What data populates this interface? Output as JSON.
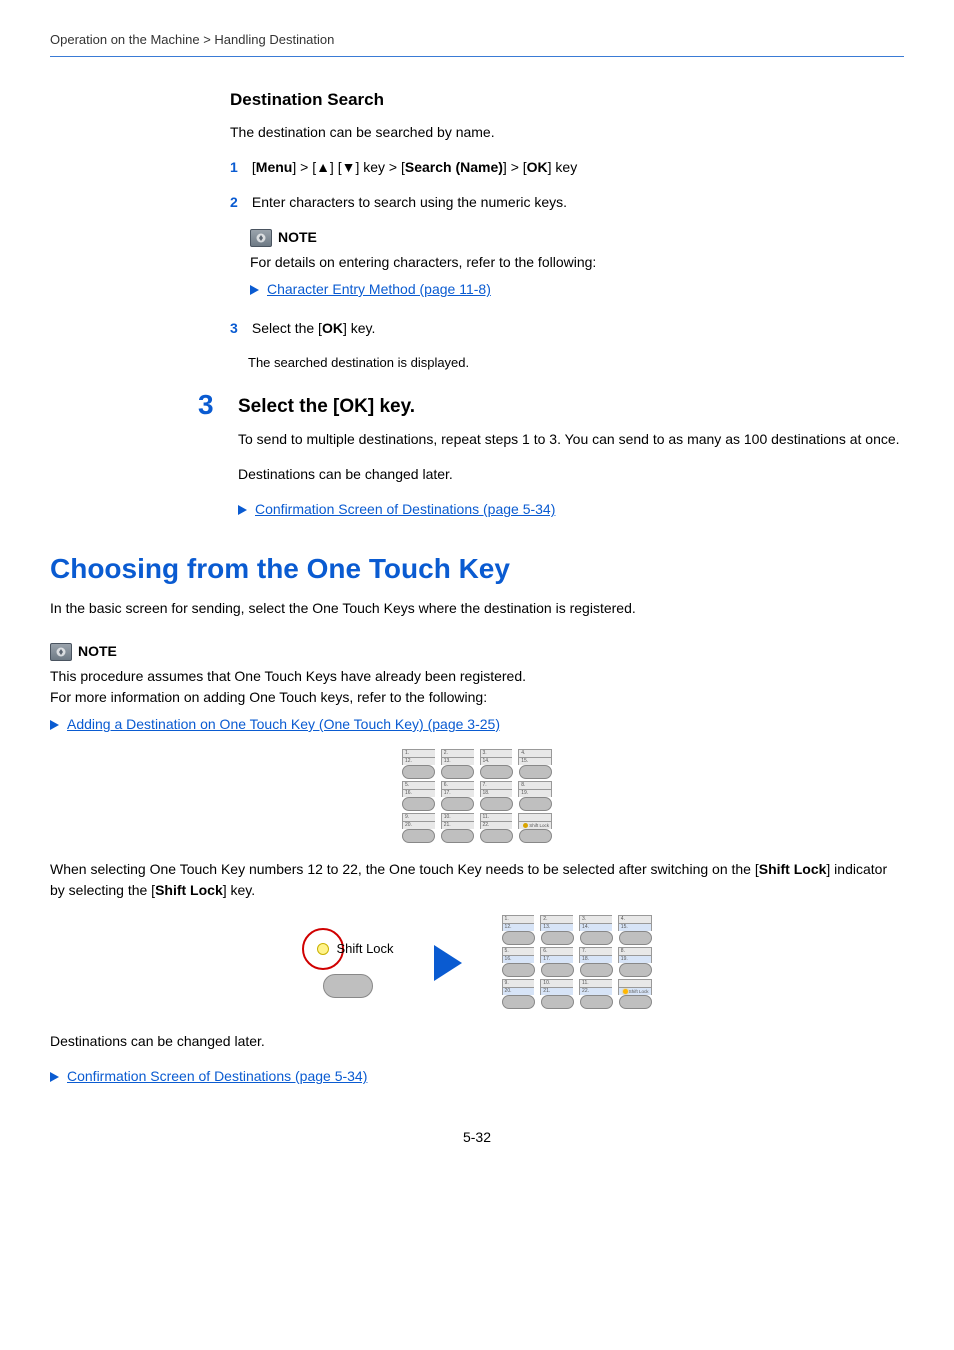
{
  "breadcrumb": "Operation on the Machine > Handling Destination",
  "dest_search": {
    "heading": "Destination Search",
    "intro": "The destination can be searched by name.",
    "steps": [
      {
        "num": "1",
        "parts": [
          "[",
          "Menu",
          "] > [▲] [▼] key > [",
          "Search (Name)",
          "] > [",
          "OK",
          "] key"
        ]
      },
      {
        "num": "2",
        "text": "Enter characters to search using the numeric keys."
      }
    ],
    "note_title": "NOTE",
    "note_body": "For details on entering characters, refer to the following:",
    "note_link": "Character Entry Method (page 11-8)",
    "step3_num": "3",
    "step3_text_pre": "Select the [",
    "step3_bold": "OK",
    "step3_text_post": "] key.",
    "step3_sub": "The searched destination is displayed."
  },
  "big_step": {
    "num": "3",
    "title": "Select the [OK] key.",
    "p1": "To send to multiple destinations, repeat steps 1 to 3. You can send to as many as 100 destinations at once.",
    "p2": "Destinations can be changed later.",
    "link": "Confirmation Screen of Destinations (page 5-34)"
  },
  "section": {
    "title": "Choosing from the One Touch Key",
    "intro": "In the basic screen for sending, select the One Touch Keys where the destination is registered.",
    "note_title": "NOTE",
    "note_line1": "This procedure assumes that One Touch Keys have already been registered.",
    "note_line2": "For more information on adding One Touch keys, refer to the following:",
    "note_link": "Adding a Destination on One Touch Key (One Touch Key) (page 3-25)",
    "shiftlock_pre": "When selecting One Touch Key numbers 12 to 22, the One touch Key needs to be selected after switching on the [",
    "shiftlock_b1": "Shift Lock",
    "shiftlock_mid": "] indicator by selecting the [",
    "shiftlock_b2": "Shift Lock",
    "shiftlock_post": "] key.",
    "shift_lock_label": "Shift Lock",
    "p_after": "Destinations can be changed later.",
    "link2": "Confirmation Screen of Destinations (page 5-34)"
  },
  "keypad_labels": {
    "r1": [
      "1.",
      "2.",
      "3.",
      "4."
    ],
    "r1b": [
      "12.",
      "13.",
      "14.",
      "15."
    ],
    "r2": [
      "5.",
      "6.",
      "7.",
      "8."
    ],
    "r2b": [
      "16.",
      "17.",
      "18.",
      "19."
    ],
    "r3": [
      "9.",
      "10.",
      "11.",
      ""
    ],
    "r3b": [
      "20.",
      "21.",
      "22.",
      "Shift Lock"
    ]
  },
  "page_number": "5-32"
}
